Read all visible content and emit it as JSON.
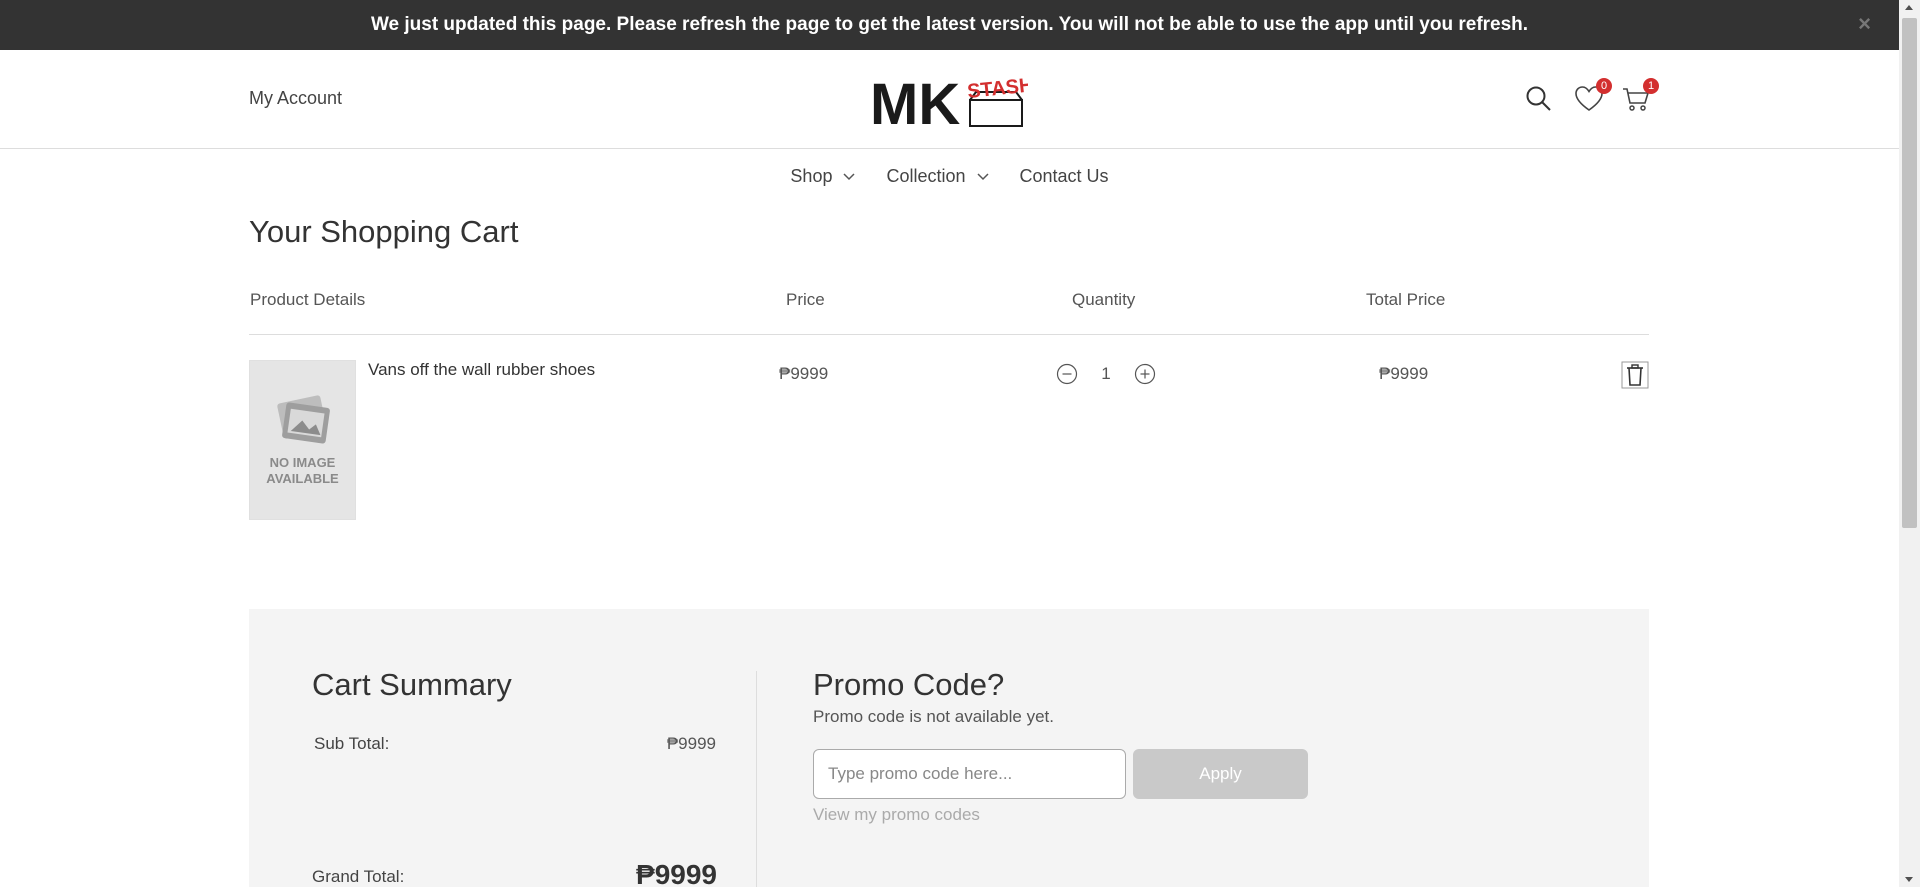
{
  "banner": {
    "message": "We just updated this page. Please refresh the page to get the latest version. You will not be able to use the app until you refresh.",
    "close_glyph": "×"
  },
  "header": {
    "my_account": "My Account",
    "logo_text_main": "MK",
    "logo_text_accent": "STASH",
    "wishlist_count": "0",
    "cart_count": "1"
  },
  "nav": {
    "items": [
      {
        "label": "Shop",
        "has_dropdown": true
      },
      {
        "label": "Collection",
        "has_dropdown": true
      },
      {
        "label": "Contact Us",
        "has_dropdown": false
      }
    ]
  },
  "page_title": "Your Shopping Cart",
  "cart": {
    "columns": [
      "Product Details",
      "Price",
      "Quantity",
      "Total Price"
    ],
    "items": [
      {
        "name": "Vans off the wall rubber shoes",
        "image_placeholder": [
          "NO IMAGE",
          "AVAILABLE"
        ],
        "price": "₱9999",
        "quantity": "1",
        "total": "₱9999"
      }
    ]
  },
  "summary": {
    "title": "Cart Summary",
    "subtotal_label": "Sub Total:",
    "subtotal_value": "₱9999",
    "grand_label": "Grand Total:",
    "grand_value": "₱9999"
  },
  "promo": {
    "title": "Promo Code?",
    "subtitle": "Promo code is not available yet.",
    "input_placeholder": "Type promo code here...",
    "apply_label": "Apply",
    "view_codes": "View my promo codes"
  },
  "colors": {
    "banner_bg": "#333333",
    "badge": "#d32f2f",
    "summary_bg": "#f4f4f4",
    "apply_disabled": "#c9c9c9"
  }
}
